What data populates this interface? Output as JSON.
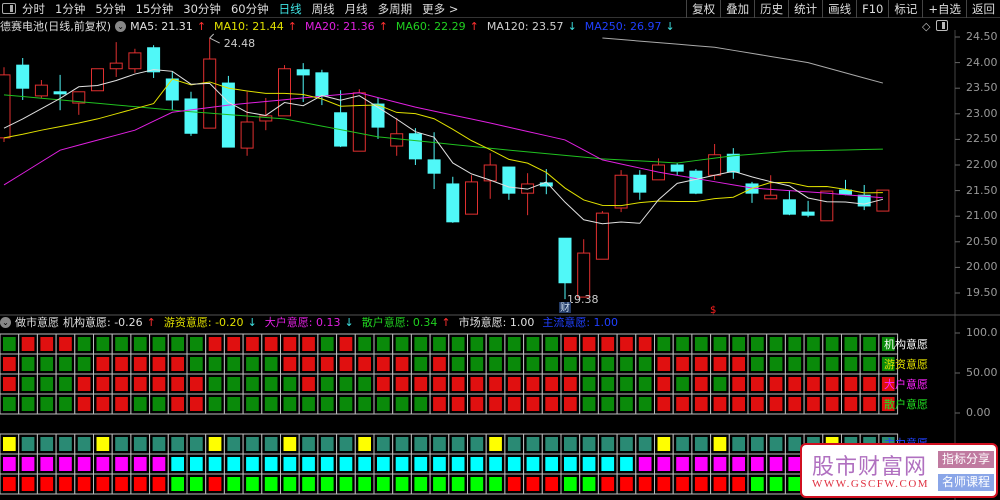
{
  "topbar": {
    "periods": [
      "分时",
      "1分钟",
      "5分钟",
      "15分钟",
      "30分钟",
      "60分钟",
      "日线",
      "周线",
      "月线",
      "多周期",
      "更多 >"
    ],
    "active": "日线",
    "buttons": [
      "复权",
      "叠加",
      "历史",
      "统计",
      "画线",
      "F10",
      "标记",
      "+自选",
      "返回"
    ]
  },
  "title": {
    "name": "德赛电池(日线,前复权)",
    "ma": [
      {
        "label": "MA5: 21.31",
        "dir": "↑",
        "color": "#e0e0e0"
      },
      {
        "label": "MA10: 21.44",
        "dir": "↑",
        "color": "#e0e000"
      },
      {
        "label": "MA20: 21.36",
        "dir": "↑",
        "color": "#e020e0"
      },
      {
        "label": "MA60: 22.29",
        "dir": "↑",
        "color": "#20d020"
      },
      {
        "label": "MA120: 23.57",
        "dir": "↓",
        "color": "#d0d0d0"
      },
      {
        "label": "MA250: 26.97",
        "dir": "↓",
        "color": "#2040ff"
      }
    ]
  },
  "price_axis": [
    "24.50",
    "24.00",
    "23.50",
    "23.00",
    "22.50",
    "22.00",
    "21.50",
    "21.00",
    "20.50",
    "20.00",
    "19.50"
  ],
  "annotations": {
    "high": "24.48",
    "low": "19.38",
    "badge": "财",
    "dollar": "$"
  },
  "colors": {
    "up": "#e03030",
    "down": "#50f8f8",
    "ma5": "#e0e0e0",
    "ma10": "#e0e000",
    "ma20": "#e020e0",
    "ma60": "#20c020",
    "ma120": "#aaaaaa"
  },
  "candles": [
    [
      22.53,
      23.91,
      22.45,
      23.76
    ],
    [
      23.95,
      24.09,
      23.27,
      23.5
    ],
    [
      23.35,
      23.66,
      23.31,
      23.56
    ],
    [
      23.43,
      23.76,
      23.07,
      23.39
    ],
    [
      23.21,
      23.43,
      22.98,
      23.43
    ],
    [
      23.45,
      23.88,
      23.45,
      23.88
    ],
    [
      23.88,
      24.4,
      23.72,
      23.99
    ],
    [
      23.88,
      24.27,
      23.8,
      24.19
    ],
    [
      24.29,
      24.34,
      23.7,
      23.82
    ],
    [
      23.68,
      23.82,
      23.07,
      23.27
    ],
    [
      23.29,
      23.43,
      22.57,
      22.62
    ],
    [
      22.72,
      24.48,
      22.72,
      24.07
    ],
    [
      23.6,
      23.74,
      22.35,
      22.35
    ],
    [
      22.33,
      23.43,
      22.18,
      22.84
    ],
    [
      22.86,
      23.31,
      22.68,
      22.96
    ],
    [
      22.96,
      23.95,
      22.96,
      23.88
    ],
    [
      23.86,
      23.99,
      23.23,
      23.76
    ],
    [
      23.8,
      23.86,
      23.17,
      23.35
    ],
    [
      23.02,
      23.46,
      22.35,
      22.37
    ],
    [
      22.27,
      23.48,
      22.27,
      23.41
    ],
    [
      23.19,
      23.31,
      22.51,
      22.74
    ],
    [
      22.37,
      22.92,
      22.18,
      22.61
    ],
    [
      22.61,
      22.72,
      22.0,
      22.12
    ],
    [
      22.1,
      22.64,
      21.53,
      21.84
    ],
    [
      21.63,
      21.77,
      20.87,
      20.89
    ],
    [
      21.04,
      21.8,
      21.04,
      21.67
    ],
    [
      21.69,
      22.23,
      21.34,
      22.0
    ],
    [
      21.96,
      21.96,
      21.32,
      21.45
    ],
    [
      21.45,
      21.84,
      21.02,
      21.63
    ],
    [
      21.65,
      21.92,
      21.43,
      21.59
    ],
    [
      20.57,
      20.57,
      19.38,
      19.7
    ],
    [
      19.42,
      20.55,
      19.42,
      20.28
    ],
    [
      20.16,
      21.1,
      20.16,
      21.06
    ],
    [
      21.16,
      21.9,
      21.08,
      21.8
    ],
    [
      21.8,
      21.9,
      21.32,
      21.47
    ],
    [
      21.71,
      22.13,
      21.71,
      22.0
    ],
    [
      22.0,
      22.04,
      21.8,
      21.88
    ],
    [
      21.88,
      21.92,
      21.43,
      21.45
    ],
    [
      21.8,
      22.41,
      21.71,
      22.2
    ],
    [
      22.21,
      22.33,
      21.73,
      21.86
    ],
    [
      21.63,
      21.67,
      21.26,
      21.45
    ],
    [
      21.34,
      21.8,
      21.34,
      21.41
    ],
    [
      21.32,
      21.51,
      21.02,
      21.04
    ],
    [
      21.08,
      21.3,
      20.98,
      21.02
    ],
    [
      20.91,
      21.49,
      20.91,
      21.49
    ],
    [
      21.51,
      21.71,
      21.41,
      21.43
    ],
    [
      21.41,
      21.61,
      21.12,
      21.2
    ],
    [
      21.1,
      21.51,
      21.1,
      21.51
    ]
  ],
  "ma5_start": [
    22.72,
    22.9,
    23.1,
    23.3
  ],
  "ma10_start": [
    22.53,
    22.6,
    22.68,
    22.75,
    22.82,
    22.9,
    23.0,
    23.1,
    23.2
  ],
  "ma20": [
    [
      0,
      21.61
    ],
    [
      3,
      22.29
    ],
    [
      7,
      22.68
    ],
    [
      9,
      23.03
    ],
    [
      12,
      23.17
    ],
    [
      16,
      23.31
    ],
    [
      19,
      23.41
    ],
    [
      22,
      23.13
    ],
    [
      26,
      22.82
    ],
    [
      30,
      22.49
    ],
    [
      32,
      22.1
    ],
    [
      35,
      21.86
    ],
    [
      40,
      21.55
    ],
    [
      44,
      21.45
    ],
    [
      47,
      21.36
    ]
  ],
  "ma60": [
    [
      0,
      23.37
    ],
    [
      10,
      23.04
    ],
    [
      15,
      22.9
    ],
    [
      20,
      22.55
    ],
    [
      27,
      22.29
    ],
    [
      32,
      22.12
    ],
    [
      36,
      22.04
    ],
    [
      39,
      22.18
    ],
    [
      42,
      22.27
    ],
    [
      47,
      22.31
    ]
  ],
  "ma120": [
    [
      32,
      24.48
    ],
    [
      38,
      24.3
    ],
    [
      43,
      24.0
    ],
    [
      47,
      23.6
    ]
  ],
  "indicator": {
    "name": "做市意愿",
    "values": [
      {
        "label": "机构意愿: -0.26",
        "dir": "↑",
        "color": "#e0e0e0",
        "dcolor": "#ff3030"
      },
      {
        "label": "游资意愿: -0.20",
        "dir": "↓",
        "color": "#e0e000",
        "dcolor": "#3ee0e0"
      },
      {
        "label": "大户意愿: 0.13",
        "dir": "↓",
        "color": "#e020e0",
        "dcolor": "#3ee0e0"
      },
      {
        "label": "散户意愿: 0.34",
        "dir": "↑",
        "color": "#20d020",
        "dcolor": "#ff3030"
      },
      {
        "label": "市场意愿: 1.00",
        "dir": "",
        "color": "#e0e0e0",
        "dcolor": ""
      },
      {
        "label": "主流意愿: 1.00",
        "dir": "",
        "color": "#2040ff",
        "dcolor": ""
      }
    ],
    "axis": [
      "100.0",
      "50.00",
      "0.00"
    ],
    "row_labels": [
      {
        "text": "机构意愿",
        "color": "#ffffff"
      },
      {
        "text": "游资意愿",
        "color": "#e0e000"
      },
      {
        "text": "大户意愿",
        "color": "#ff20ff"
      },
      {
        "text": "散户意愿",
        "color": "#20e020"
      },
      {
        "text": "主力意愿",
        "color": "#2040ff"
      }
    ],
    "rows": [
      "GRRRGGGGGGGRRRRRRGRGGGGGGGGGGGRRRRRGGGGGGGGGGGGG",
      "RGGGGRRRRRGGGGGRRRRRRRGRGGGGGGGGGGGRRRRRGGGGGGGG",
      "RGGGRRRRRRRGGGGGRGGGRRRRRRRRRRRGGGGRGRGRRRRRRRRR",
      "GGGGRRRGGRRGGGGGGGGGGGGRRRRRRRRGGGGRRRRRRRRRRRRR"
    ],
    "signal_rows": [
      "YTTTTYTTTTTYTTTYTTTYTTTTTTYTTTTTTTTYTTYTTTTTYTTT",
      "MMMMMMMMMCCCCCCCCCCCCCCCCCCCCCCCCCMMMMMMMMMMMMMM",
      "RRRRRRRRRGGRGGGGGGGGGGGGGGGRRRGGRRRRRRRRGGGGGGGG"
    ]
  },
  "watermark": {
    "title": "股市财富网",
    "url": "WWW.GSCFW.COM",
    "btn1": "指标分享",
    "btn2": "名师课程"
  }
}
